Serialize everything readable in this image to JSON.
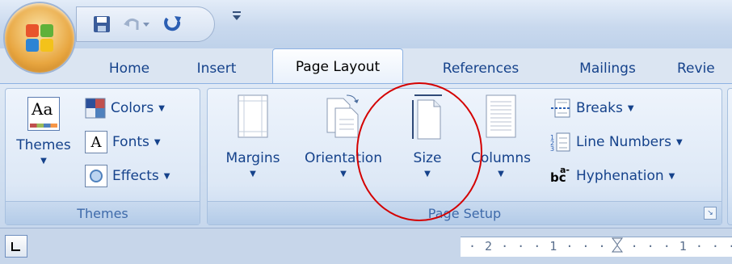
{
  "tabs": [
    {
      "label": "Home",
      "active": false
    },
    {
      "label": "Insert",
      "active": false
    },
    {
      "label": "Page Layout",
      "active": true
    },
    {
      "label": "References",
      "active": false
    },
    {
      "label": "Mailings",
      "active": false
    },
    {
      "label": "Revie",
      "active": false
    }
  ],
  "quick_access": {
    "icons": [
      "save-icon",
      "undo-icon",
      "redo-icon",
      "customize-icon"
    ]
  },
  "themes_group": {
    "label": "Themes",
    "themes_button": "Themes",
    "colors_button": "Colors",
    "fonts_button": "Fonts",
    "effects_button": "Effects",
    "themes_icon_text": "Aa",
    "fonts_icon_text": "A"
  },
  "page_setup_group": {
    "label": "Page Setup",
    "margins": "Margins",
    "orientation": "Orientation",
    "size": "Size",
    "columns": "Columns",
    "breaks": "Breaks",
    "line_numbers": "Line Numbers",
    "hyphenation": "Hyphenation",
    "hyphenation_icon_text": "bc",
    "hyphenation_icon_sup": "a-"
  },
  "ruler": {
    "text": "· 2 · · · 1 · · ·   · · · 1 · · ·"
  },
  "annotation": {
    "color": "#d40000",
    "target": "size-button"
  }
}
